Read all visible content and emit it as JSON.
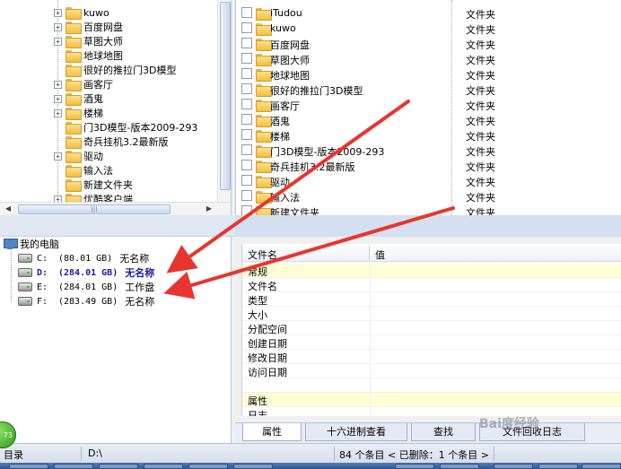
{
  "tree": {
    "items": [
      {
        "label": "kuwo",
        "expandable": true
      },
      {
        "label": "百度网盘",
        "expandable": true
      },
      {
        "label": "草图大师",
        "expandable": true
      },
      {
        "label": "地球地图",
        "expandable": false
      },
      {
        "label": "很好的推拉门3D模型",
        "expandable": false
      },
      {
        "label": "画客厅",
        "expandable": true
      },
      {
        "label": "酒鬼",
        "expandable": true
      },
      {
        "label": "楼梯",
        "expandable": true
      },
      {
        "label": "门3D模型-版本2009-293",
        "expandable": false
      },
      {
        "label": "奇兵挂机3.2最新版",
        "expandable": false
      },
      {
        "label": "驱动",
        "expandable": true
      },
      {
        "label": "输入法",
        "expandable": false
      },
      {
        "label": "新建文件夹",
        "expandable": false
      },
      {
        "label": "优酷客户端",
        "expandable": true
      }
    ],
    "hscroll_grip": "|||"
  },
  "file_list": {
    "rows": [
      {
        "name": "iTudou",
        "type": "文件夹"
      },
      {
        "name": "kuwo",
        "type": "文件夹"
      },
      {
        "name": "百度网盘",
        "type": "文件夹"
      },
      {
        "name": "草图大师",
        "type": "文件夹"
      },
      {
        "name": "地球地图",
        "type": "文件夹"
      },
      {
        "name": "很好的推拉门3D模型",
        "type": "文件夹"
      },
      {
        "name": "画客厅",
        "type": "文件夹"
      },
      {
        "name": "酒鬼",
        "type": "文件夹"
      },
      {
        "name": "楼梯",
        "type": "文件夹"
      },
      {
        "name": "门3D模型-版本2009-293",
        "type": "文件夹"
      },
      {
        "name": "奇兵挂机3.2最新版",
        "type": "文件夹"
      },
      {
        "name": "驱动",
        "type": "文件夹"
      },
      {
        "name": "输入法",
        "type": "文件夹"
      },
      {
        "name": "新建文件夹",
        "type": "文件夹"
      }
    ]
  },
  "drives": {
    "root_label": "我的电脑",
    "items": [
      {
        "letter": "C:",
        "size": "(80.01 GB)",
        "label": "无名称",
        "selected": false
      },
      {
        "letter": "D:",
        "size": "(284.01 GB)",
        "label": "无名称",
        "selected": true
      },
      {
        "letter": "E:",
        "size": "(284.01 GB)",
        "label": "工作盘",
        "selected": false
      },
      {
        "letter": "F:",
        "size": "(283.49 GB)",
        "label": "无名称",
        "selected": false
      }
    ]
  },
  "properties": {
    "col_name": "文件名",
    "col_value": "值",
    "rows": [
      {
        "key": "常规",
        "highlight": true
      },
      {
        "key": "文件名",
        "highlight": false
      },
      {
        "key": "类型",
        "highlight": false
      },
      {
        "key": "大小",
        "highlight": false
      },
      {
        "key": "分配空间",
        "highlight": false
      },
      {
        "key": "创建日期",
        "highlight": false
      },
      {
        "key": "修改日期",
        "highlight": false
      },
      {
        "key": "访问日期",
        "highlight": false
      },
      {
        "key": "",
        "highlight": false
      },
      {
        "key": "属性",
        "highlight": true
      },
      {
        "key": "日志",
        "highlight": false
      }
    ]
  },
  "tabs": [
    {
      "label": "属性",
      "active": true
    },
    {
      "label": "十六进制查看",
      "active": false
    },
    {
      "label": "查找",
      "active": false
    },
    {
      "label": "文件回收日志",
      "active": false
    }
  ],
  "status": {
    "left": "目录",
    "path": "D:\\",
    "summary": "84 个条目 < 已删除：1 个条目 >"
  },
  "watermark": "Bai度经验",
  "orb_text": "73",
  "colors": {
    "arrow": "#e8352f",
    "selected_text": "#1a1aa0",
    "highlight_row": "#ffffd6"
  }
}
